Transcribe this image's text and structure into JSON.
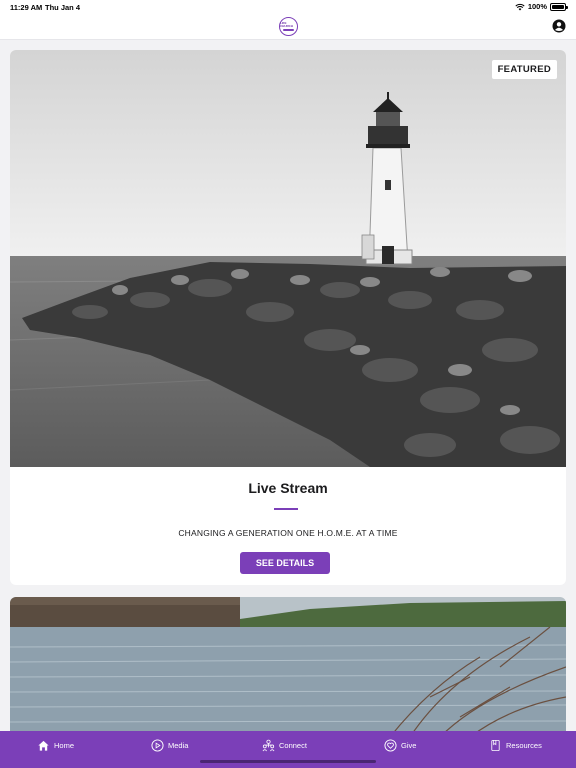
{
  "status": {
    "time": "11:29 AM",
    "date": "Thu Jan 4",
    "battery": "100%",
    "battery_level": 1.0
  },
  "header": {
    "logo_text": "LIFE CHURCH"
  },
  "featured_card": {
    "badge": "FEATURED",
    "title": "Live Stream",
    "subtitle": "CHANGING A GENERATION ONE H.O.M.E. AT A TIME",
    "button_label": "SEE DETAILS"
  },
  "tabs": [
    {
      "label": "Home",
      "icon": "home-icon"
    },
    {
      "label": "Media",
      "icon": "play-icon"
    },
    {
      "label": "Connect",
      "icon": "people-icon"
    },
    {
      "label": "Give",
      "icon": "heart-icon"
    },
    {
      "label": "Resources",
      "icon": "book-icon"
    }
  ],
  "colors": {
    "accent": "#7b3fb8",
    "background": "#f2f2f4"
  }
}
